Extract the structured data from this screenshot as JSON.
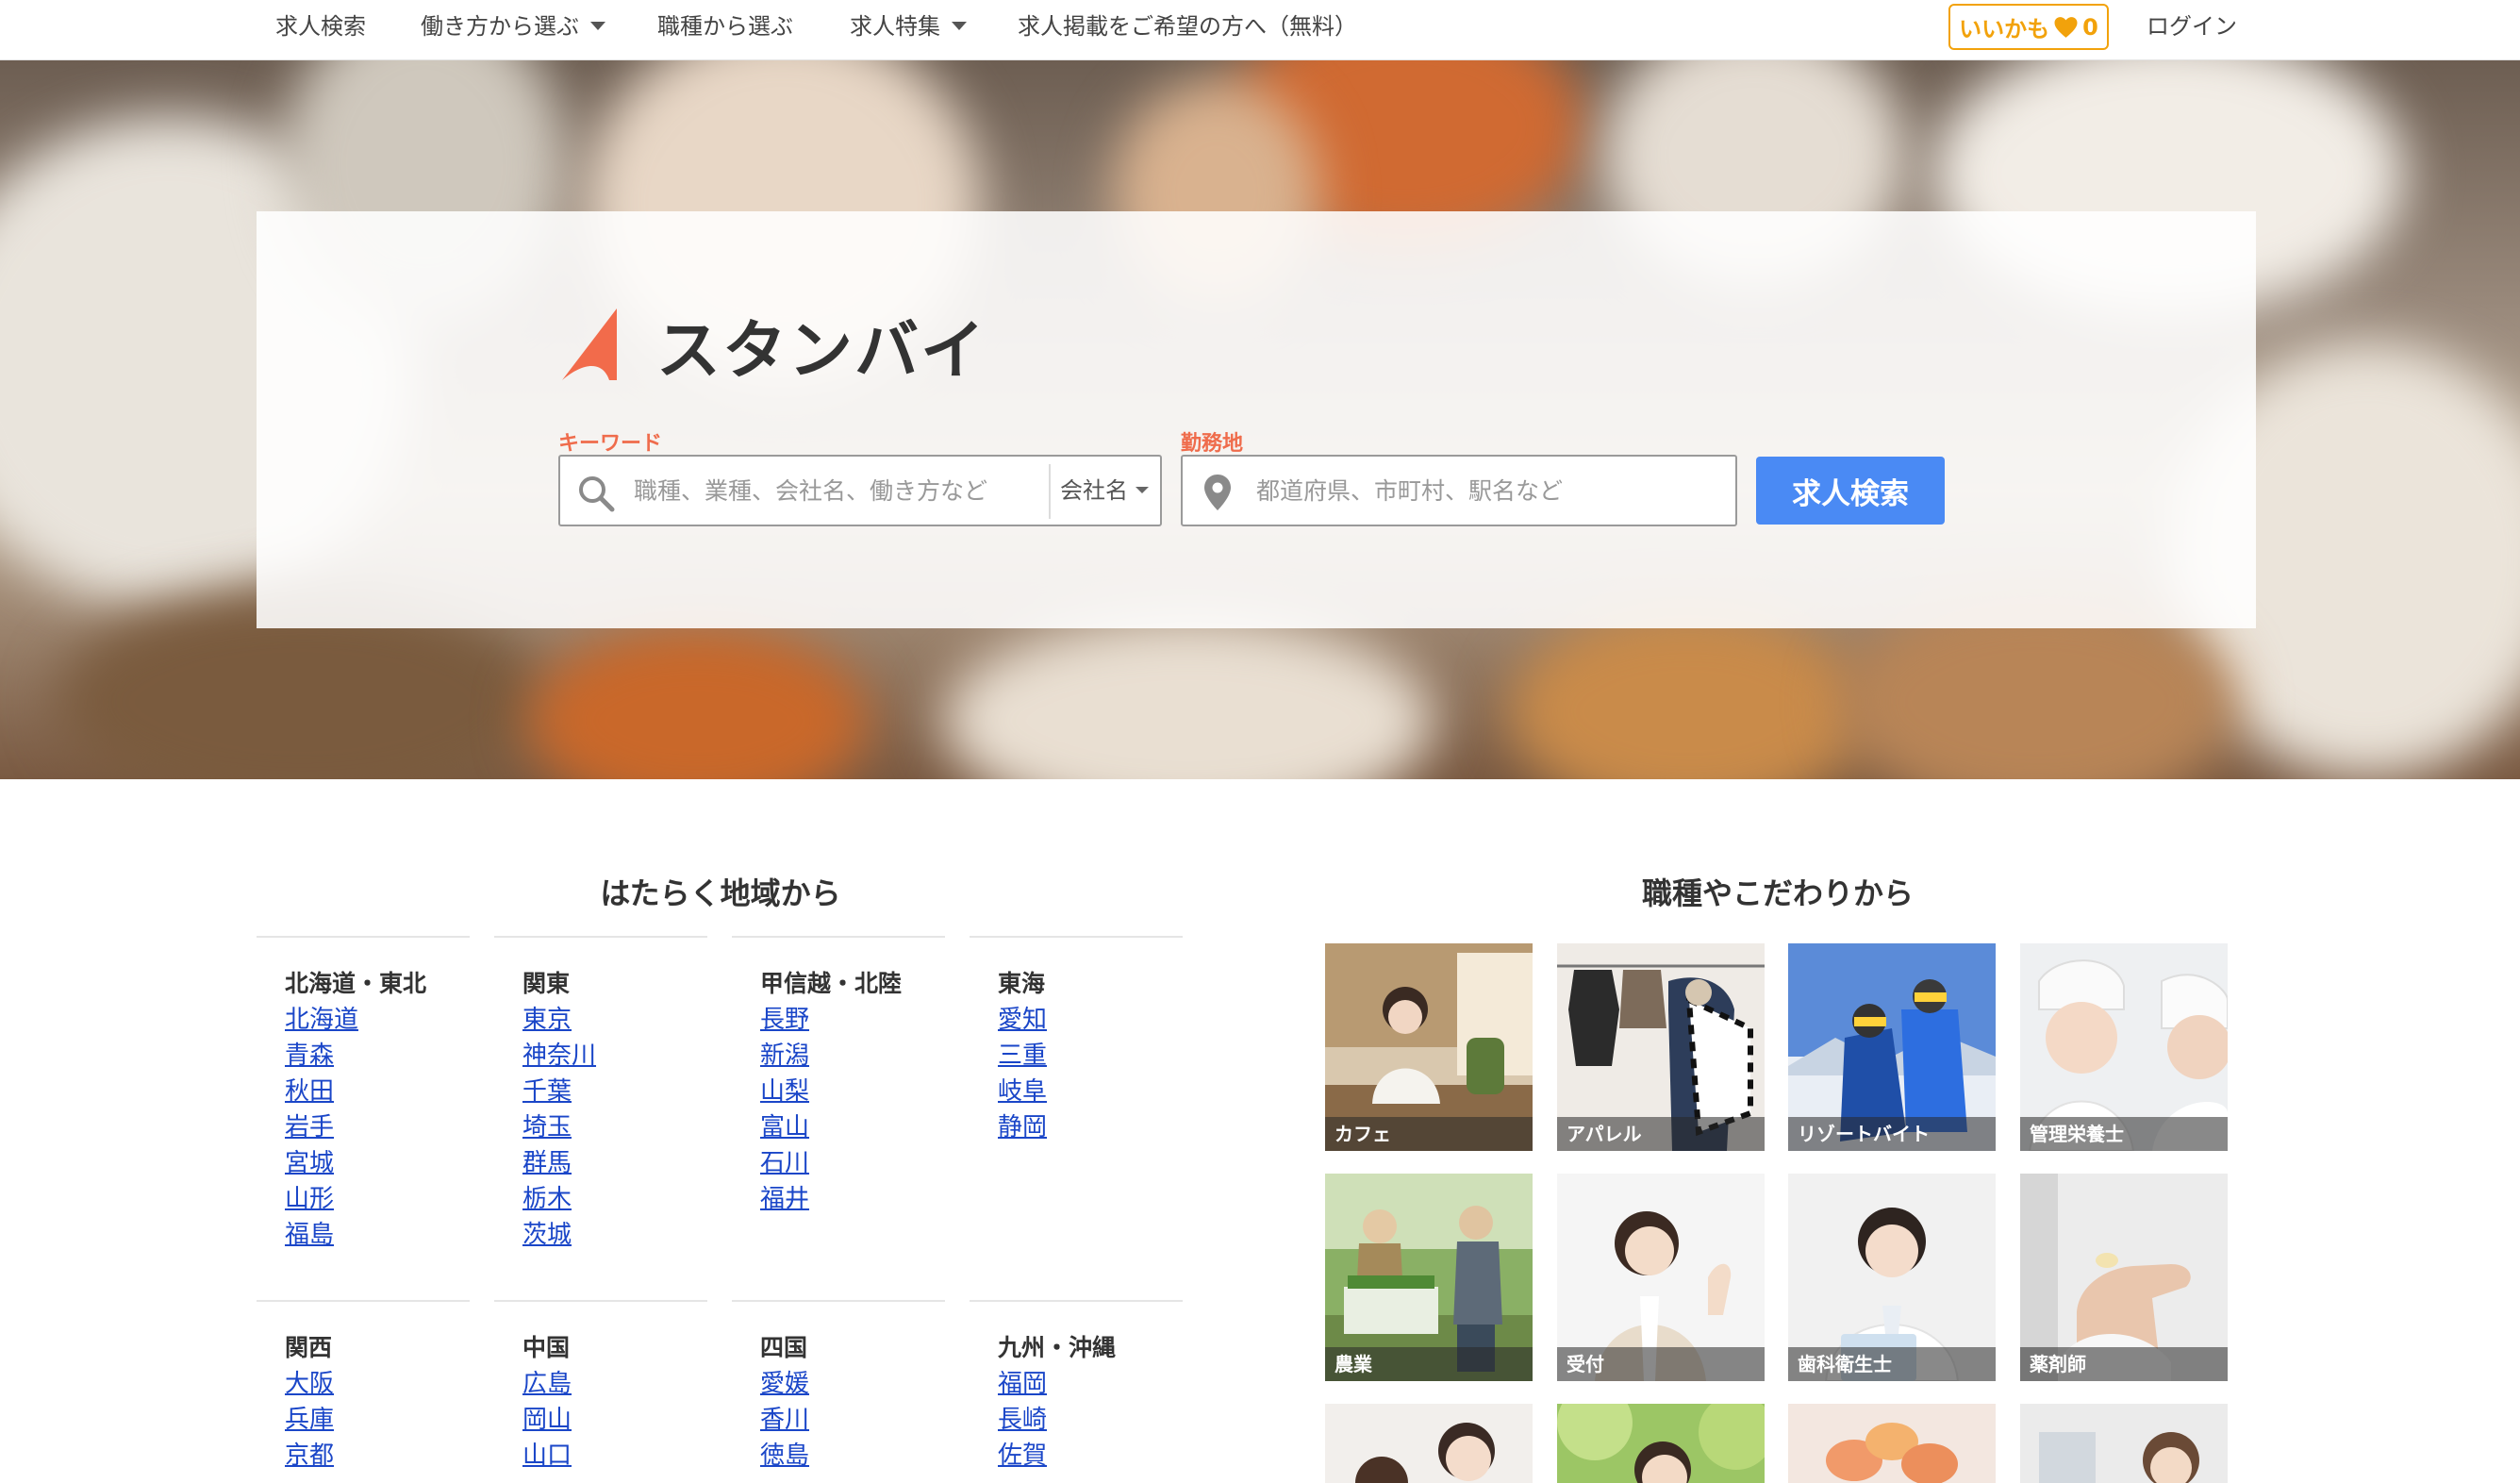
{
  "nav": {
    "items": [
      {
        "label": "求人検索"
      },
      {
        "label": "働き方から選ぶ"
      },
      {
        "label": "職種から選ぶ"
      },
      {
        "label": "求人特集"
      },
      {
        "label": "求人掲載をご希望の方へ（無料）"
      }
    ],
    "like_label": "いいかも",
    "like_count": "0",
    "login_label": "ログイン"
  },
  "brand": {
    "name": "スタンバイ",
    "accent": "#f26b4b"
  },
  "search": {
    "keyword_label": "キーワード",
    "keyword_placeholder": "職種、業種、会社名、働き方など",
    "keyword_type": "会社名",
    "location_label": "勤務地",
    "location_placeholder": "都道府県、市町村、駅名など",
    "button_label": "求人検索",
    "button_color": "#4a8af4"
  },
  "regions": {
    "title": "はたらく地域から",
    "groups": [
      {
        "name": "北海道・東北",
        "prefs": [
          "北海道",
          "青森",
          "秋田",
          "岩手",
          "宮城",
          "山形",
          "福島"
        ]
      },
      {
        "name": "関東",
        "prefs": [
          "東京",
          "神奈川",
          "千葉",
          "埼玉",
          "群馬",
          "栃木",
          "茨城"
        ]
      },
      {
        "name": "甲信越・北陸",
        "prefs": [
          "長野",
          "新潟",
          "山梨",
          "富山",
          "石川",
          "福井"
        ]
      },
      {
        "name": "東海",
        "prefs": [
          "愛知",
          "三重",
          "岐阜",
          "静岡"
        ]
      },
      {
        "name": "関西",
        "prefs": [
          "大阪",
          "兵庫",
          "京都"
        ]
      },
      {
        "name": "中国",
        "prefs": [
          "広島",
          "岡山",
          "山口"
        ]
      },
      {
        "name": "四国",
        "prefs": [
          "愛媛",
          "香川",
          "徳島"
        ]
      },
      {
        "name": "九州・沖縄",
        "prefs": [
          "福岡",
          "長崎",
          "佐賀"
        ]
      }
    ]
  },
  "jobs": {
    "title": "職種やこだわりから",
    "tiles": [
      {
        "label": "カフェ"
      },
      {
        "label": "アパレル"
      },
      {
        "label": "リゾートバイト"
      },
      {
        "label": "管理栄養士"
      },
      {
        "label": "農業"
      },
      {
        "label": "受付"
      },
      {
        "label": "歯科衛生士"
      },
      {
        "label": "薬剤師"
      },
      {
        "label": ""
      },
      {
        "label": ""
      },
      {
        "label": ""
      },
      {
        "label": ""
      }
    ]
  }
}
